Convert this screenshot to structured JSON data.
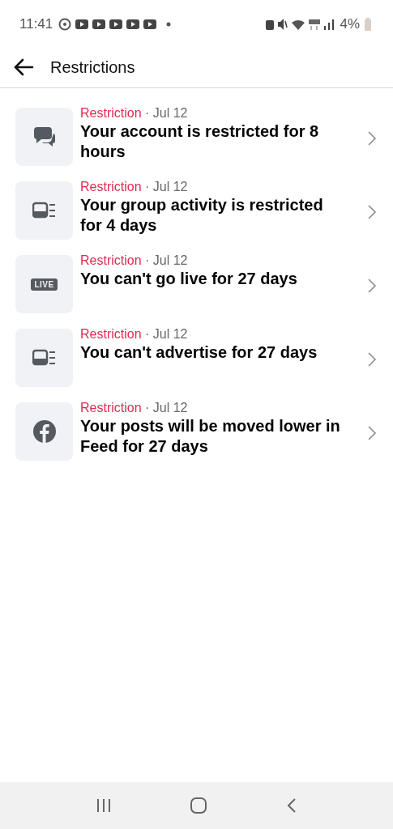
{
  "status_bar": {
    "time": "11:41",
    "battery": "4%"
  },
  "header": {
    "title": "Restrictions"
  },
  "items": [
    {
      "kind": "chat",
      "category": "Restriction",
      "date": "· Jul 12",
      "title": "Your account is restricted for 8 hours"
    },
    {
      "kind": "device",
      "category": "Restriction",
      "date": "· Jul 12",
      "title": "Your group activity is restricted for 4 days"
    },
    {
      "kind": "live",
      "badge": "LIVE",
      "category": "Restriction",
      "date": "· Jul 12",
      "title": "You can't go live for 27 days"
    },
    {
      "kind": "device",
      "category": "Restriction",
      "date": "· Jul 12",
      "title": "You can't advertise for 27 days"
    },
    {
      "kind": "facebook",
      "category": "Restriction",
      "date": "· Jul 12",
      "title": "Your posts will be moved lower in Feed for 27 days"
    }
  ]
}
